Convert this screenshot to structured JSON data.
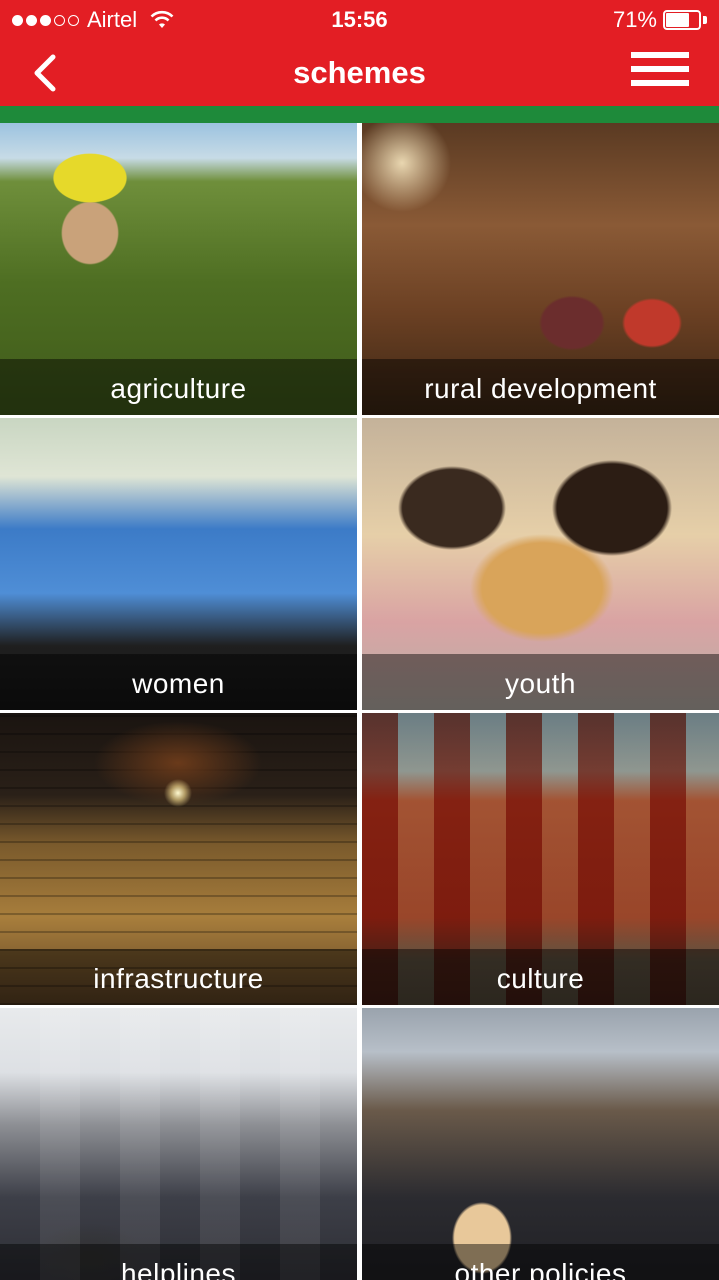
{
  "status_bar": {
    "carrier": "Airtel",
    "signal_bars_filled": 3,
    "signal_bars_total": 5,
    "time": "15:56",
    "battery_percent_text": "71%",
    "battery_level": 0.71,
    "icons": [
      "signal-dots-icon",
      "wifi-icon",
      "battery-icon"
    ]
  },
  "header": {
    "title": "schemes",
    "back_icon": "chevron-left-icon",
    "menu_icon": "hamburger-menu-icon"
  },
  "colors": {
    "primary_red": "#e31e24",
    "accent_green": "#1e8a3a",
    "label_text": "#ffffff"
  },
  "tiles": [
    {
      "label": "agriculture"
    },
    {
      "label": "rural development"
    },
    {
      "label": "women"
    },
    {
      "label": "youth"
    },
    {
      "label": "infrastructure"
    },
    {
      "label": "culture"
    },
    {
      "label": "helplines"
    },
    {
      "label": "other policies"
    }
  ]
}
